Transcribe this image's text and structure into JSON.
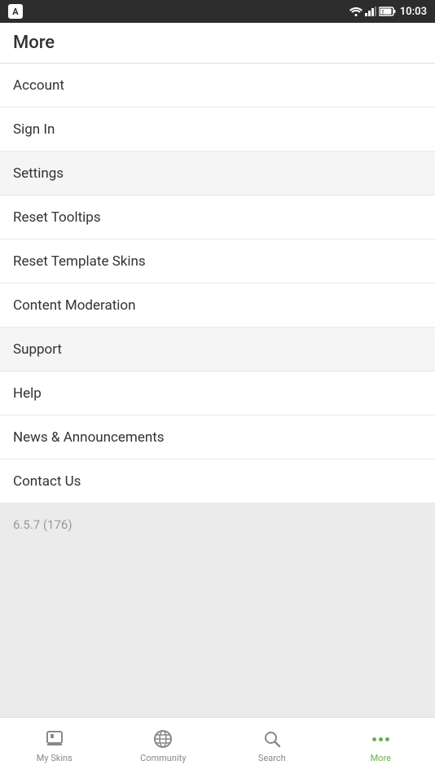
{
  "statusBar": {
    "time": "10:03",
    "appIconLabel": "A"
  },
  "header": {
    "title": "More"
  },
  "menuItems": [
    {
      "id": "account",
      "label": "Account",
      "shaded": false
    },
    {
      "id": "sign-in",
      "label": "Sign In",
      "shaded": false
    },
    {
      "id": "settings",
      "label": "Settings",
      "shaded": true
    },
    {
      "id": "reset-tooltips",
      "label": "Reset Tooltips",
      "shaded": false
    },
    {
      "id": "reset-template-skins",
      "label": "Reset Template Skins",
      "shaded": false
    },
    {
      "id": "content-moderation",
      "label": "Content Moderation",
      "shaded": false
    },
    {
      "id": "support",
      "label": "Support",
      "shaded": true
    },
    {
      "id": "help",
      "label": "Help",
      "shaded": false
    },
    {
      "id": "news-announcements",
      "label": "News & Announcements",
      "shaded": false
    },
    {
      "id": "contact-us",
      "label": "Contact Us",
      "shaded": false
    }
  ],
  "version": {
    "label": "6.5.7 (176)"
  },
  "bottomNav": {
    "items": [
      {
        "id": "my-skins",
        "label": "My Skins",
        "active": false
      },
      {
        "id": "community",
        "label": "Community",
        "active": false
      },
      {
        "id": "search",
        "label": "Search",
        "active": false
      },
      {
        "id": "more",
        "label": "More",
        "active": true
      }
    ]
  }
}
